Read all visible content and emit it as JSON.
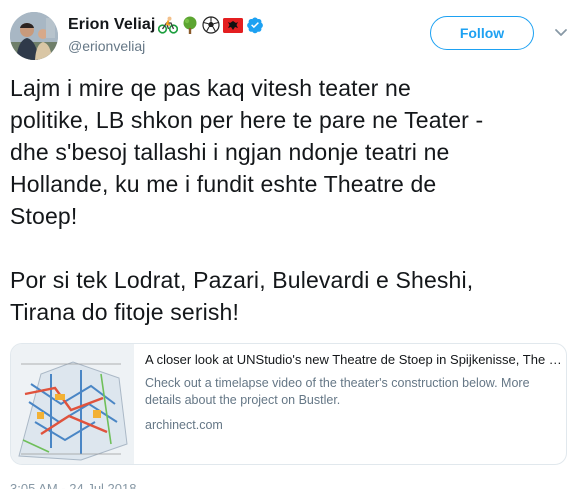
{
  "author": {
    "display_name": "Erion Veliaj",
    "handle": "@erionveliaj",
    "emoji": [
      "cyclist",
      "tree",
      "soccer-ball",
      "albania-flag"
    ]
  },
  "follow_label": "Follow",
  "tweet": {
    "lines_1": [
      "Lajm i mire qe pas kaq vitesh teater ne",
      "politike, LB shkon per here te pare ne Teater -",
      "dhe s'besoj tallashi i ngjan ndonje teatri ne",
      "Hollande, ku me i fundit eshte Theatre de",
      "Stoep!"
    ],
    "lines_2": [
      "Por si tek Lodrat, Pazari, Bulevardi e Sheshi,",
      "Tirana do fitoje serish!"
    ]
  },
  "card": {
    "title": "A closer look at UNStudio's new Theatre de Stoep in Spijkenisse, The Nether…",
    "description": "Check out a timelapse video of the theater's construction below. More details about the project on Bustler.",
    "domain": "archinect.com"
  },
  "timestamp": "3:05 AM - 24 Jul 2018",
  "colors": {
    "accent": "#1da1f2",
    "secondary_text": "#657786"
  }
}
